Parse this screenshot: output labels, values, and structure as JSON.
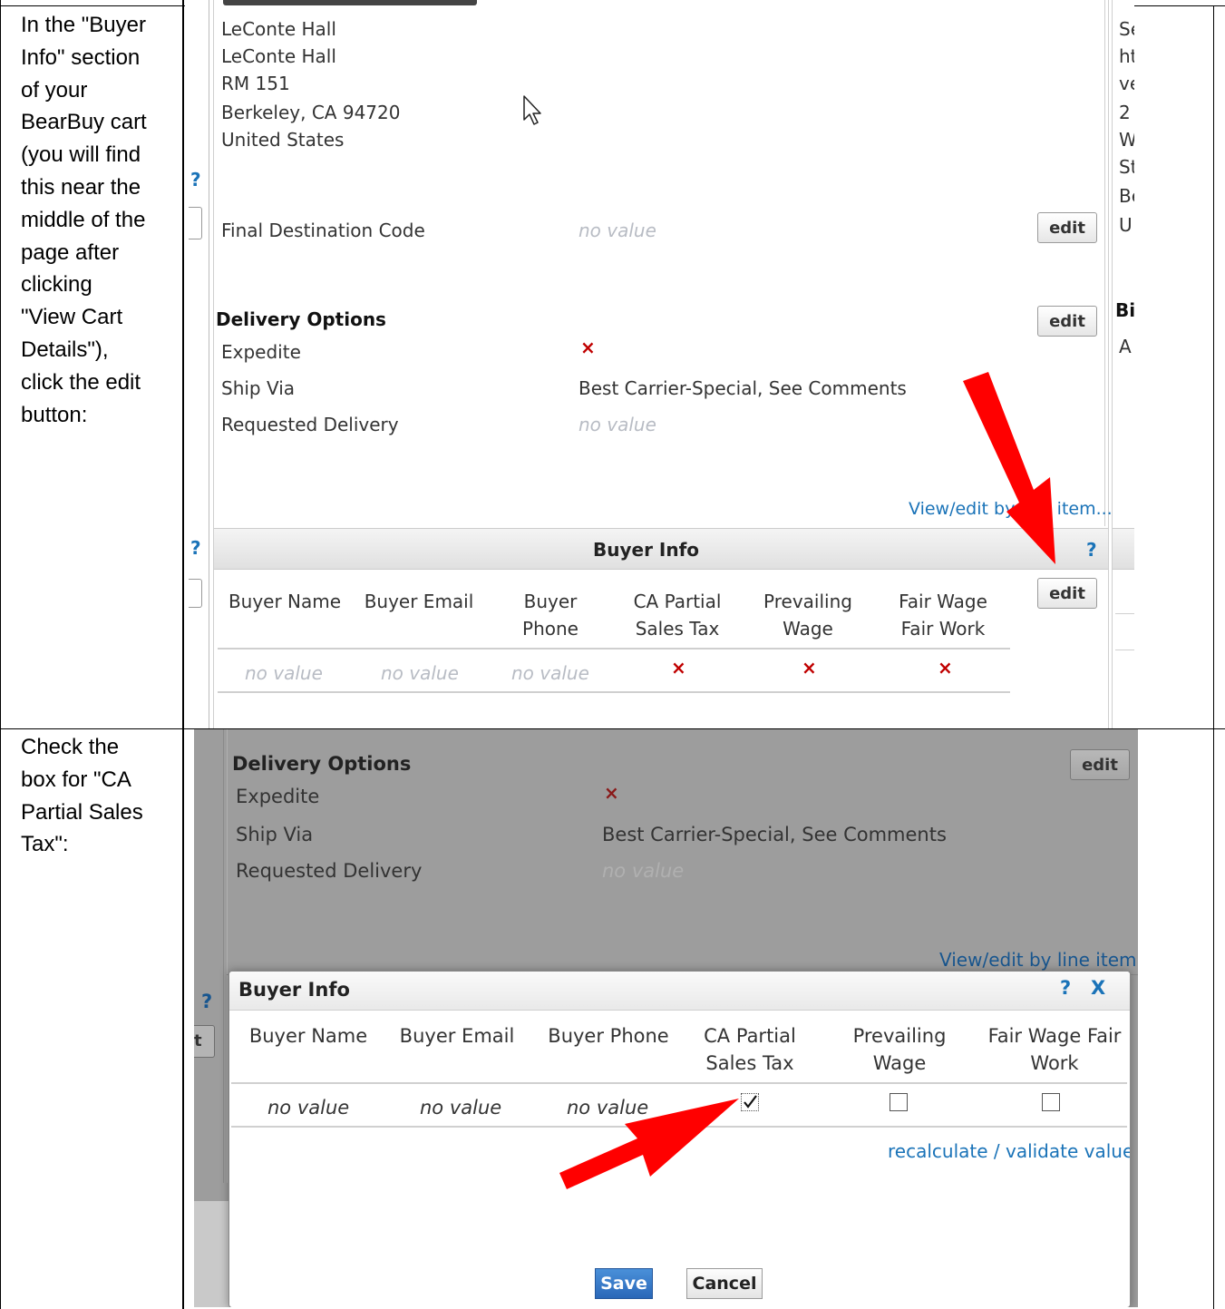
{
  "instructions": {
    "step1": [
      "In the \"Buyer",
      "Info\" section",
      "of your",
      "BearBuy cart",
      "(you will find",
      "this near the",
      "middle of the",
      "page after",
      "clicking",
      "\"View Cart",
      "Details\"),",
      "click the edit",
      "button:"
    ],
    "step2": [
      "Check the",
      "box for \"CA",
      "Partial Sales",
      "Tax\":"
    ]
  },
  "shot1": {
    "address": [
      "LeConte Hall",
      "LeConte Hall",
      "RM 151",
      "Berkeley, CA 94720",
      "United States"
    ],
    "right_col_fragments": [
      "Se",
      "ht",
      "ve",
      "2",
      "W",
      "St",
      "Be",
      "U"
    ],
    "bi_fragment": "Bi",
    "a_fragment": "A",
    "help_mark": "?",
    "final_destination_label": "Final Destination Code",
    "no_value": "no value",
    "edit_label": "edit",
    "delivery_title": "Delivery Options",
    "expedite_label": "Expedite",
    "ship_via_label": "Ship Via",
    "ship_via_value": "Best Carrier-Special, See Comments",
    "requested_delivery_label": "Requested Delivery",
    "view_edit_link": "View/edit by line item...",
    "buyer_info_title": "Buyer Info",
    "columns": [
      "Buyer Name",
      "Buyer Email",
      "Buyer Phone",
      "CA Partial Sales Tax",
      "Prevailing Wage",
      "Fair Wage Fair Work"
    ],
    "x_mark": "×"
  },
  "shot2": {
    "delivery_title": "Delivery Options",
    "edit_label": "edit",
    "expedite_label": "Expedite",
    "ship_via_label": "Ship Via",
    "ship_via_value": "Best Carrier-Special, See Comments",
    "requested_delivery_label": "Requested Delivery",
    "no_value": "no value",
    "view_edit_link": "View/edit by line item...",
    "modal_title": "Buyer Info",
    "help_mark": "?",
    "close_mark": "X",
    "columns": [
      "Buyer Name",
      "Buyer Email",
      "Buyer Phone",
      "CA Partial Sales Tax",
      "Prevailing Wage",
      "Fair Wage Fair Work"
    ],
    "ca_partial_sales_tax_checked": true,
    "prevailing_wage_checked": false,
    "fair_wage_checked": false,
    "recalculate_link": "recalculate / validate values",
    "save_label": "Save",
    "cancel_label": "Cancel",
    "bg_fragment_t": "t"
  },
  "colors": {
    "arrow": "#ff0000",
    "link": "#1a73b8",
    "x_mark": "#c00000",
    "overlay": "#9d9d9d"
  }
}
